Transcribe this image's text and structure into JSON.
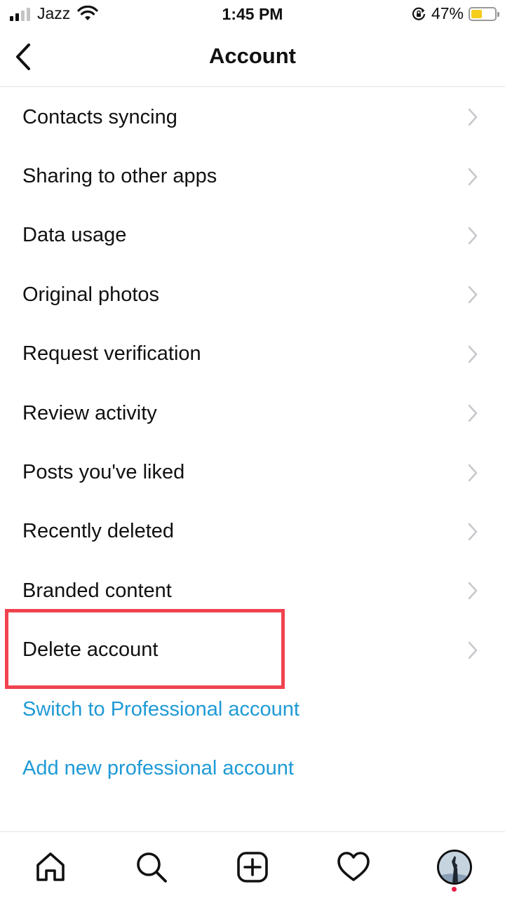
{
  "status_bar": {
    "carrier": "Jazz",
    "time": "1:45 PM",
    "battery_percent": "47%",
    "battery_level": 0.47,
    "battery_color": "#f6cc1a"
  },
  "header": {
    "title": "Account",
    "back_icon": "chevron-left-icon"
  },
  "menu": {
    "items": [
      {
        "label": "Contacts syncing"
      },
      {
        "label": "Sharing to other apps"
      },
      {
        "label": "Data usage"
      },
      {
        "label": "Original photos"
      },
      {
        "label": "Request verification"
      },
      {
        "label": "Review activity"
      },
      {
        "label": "Posts you've liked"
      },
      {
        "label": "Recently deleted"
      },
      {
        "label": "Branded content"
      },
      {
        "label": "Delete account"
      }
    ],
    "links": [
      {
        "label": "Switch to Professional account"
      },
      {
        "label": "Add new professional account"
      }
    ],
    "link_color": "#1f9ad6",
    "highlight_color": "#f0434f",
    "highlighted_item": "Delete account"
  },
  "bottom_nav": {
    "items": [
      "home-icon",
      "search-icon",
      "new-post-icon",
      "activity-heart-icon",
      "profile-avatar"
    ],
    "notification_dot_color": "#ed1c45"
  }
}
